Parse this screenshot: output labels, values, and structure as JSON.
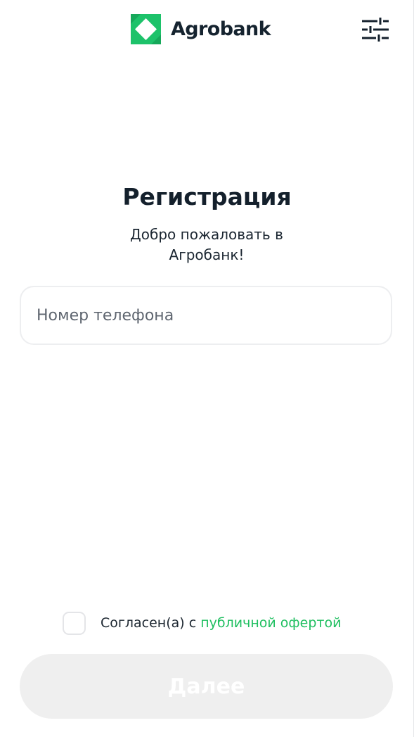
{
  "header": {
    "brand_name": "Agrobank",
    "logo_icon": "agrobank-logo-icon",
    "settings_icon": "sliders-icon"
  },
  "main": {
    "title": "Регистрация",
    "subtitle": "Добро пожаловать в Агробанк!",
    "phone_field": {
      "placeholder": "Номер телефона",
      "value": ""
    }
  },
  "agreement": {
    "checked": false,
    "text_prefix": "Согласен(а) с ",
    "link_text": "публичной офертой"
  },
  "actions": {
    "next_label": "Далее",
    "next_enabled": false
  },
  "colors": {
    "brand_green": "#1fbf60",
    "text_dark": "#14202c",
    "disabled_button": "#efefef"
  }
}
